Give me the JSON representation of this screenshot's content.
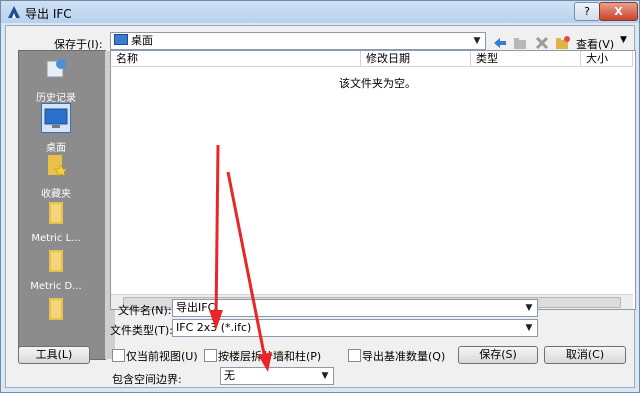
{
  "window": {
    "title": "导出 IFC",
    "help": "?",
    "close": "X"
  },
  "save_in": {
    "label": "保存于(I):",
    "value": "桌面"
  },
  "toolbar": {
    "view_label": "查看(V)"
  },
  "places": [
    {
      "label": "历史记录",
      "icon": "history-icon"
    },
    {
      "label": "桌面",
      "icon": "desktop-icon"
    },
    {
      "label": "收藏夹",
      "icon": "favorites-icon"
    },
    {
      "label": "Metric L...",
      "icon": "folder-icon"
    },
    {
      "label": "Metric D...",
      "icon": "folder-icon"
    },
    {
      "label": "",
      "icon": "folder-icon"
    }
  ],
  "columns": [
    "名称",
    "修改日期",
    "类型",
    "大小"
  ],
  "empty_message": "该文件夹为空。",
  "filename": {
    "label": "文件名(N):",
    "value": "导出IFC"
  },
  "filetype": {
    "label": "文件类型(T):",
    "value": "IFC 2x3 (*.ifc)"
  },
  "tools_button": "工具(L)",
  "options": [
    {
      "label": "仅当前视图(U)",
      "checked": false
    },
    {
      "label": "按楼层拆分墙和柱(P)",
      "checked": false
    },
    {
      "label": "导出基准数量(Q)",
      "checked": false
    }
  ],
  "space_boundary": {
    "label": "包含空间边界:",
    "value": "无"
  },
  "save_button": "保存(S)",
  "cancel_button": "取消(C)",
  "colors": {
    "annotation_arrow": "#e8262a",
    "places_bg": "#8c8c8c"
  }
}
